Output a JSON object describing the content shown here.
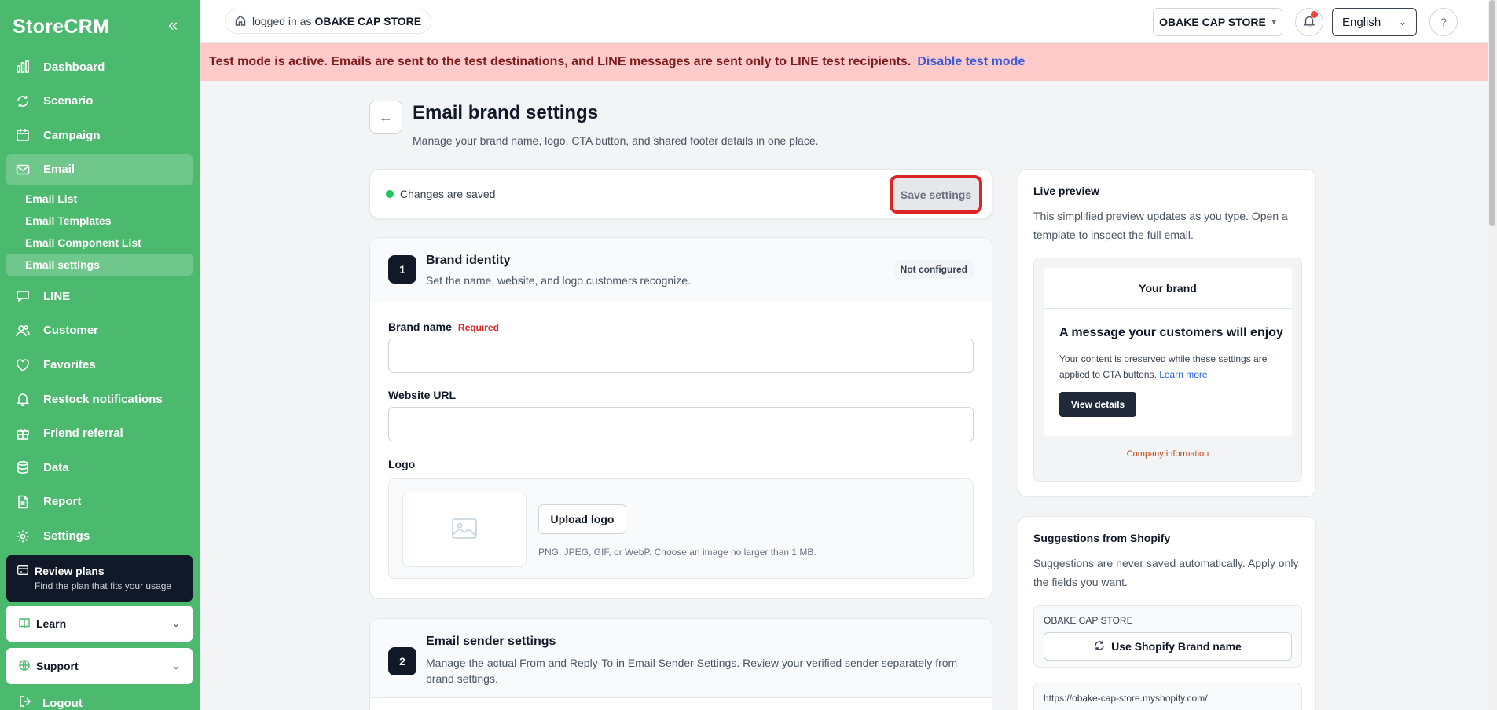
{
  "app": {
    "name": "StoreCRM"
  },
  "sidebar": {
    "items": [
      {
        "label": "Dashboard",
        "icon": "bar-chart-icon"
      },
      {
        "label": "Scenario",
        "icon": "refresh-icon"
      },
      {
        "label": "Campaign",
        "icon": "calendar-icon"
      },
      {
        "label": "Email",
        "icon": "mail-icon",
        "active": true
      },
      {
        "label": "LINE",
        "icon": "chat-icon"
      },
      {
        "label": "Customer",
        "icon": "users-icon"
      },
      {
        "label": "Favorites",
        "icon": "heart-icon"
      },
      {
        "label": "Restock notifications",
        "icon": "bell-icon"
      },
      {
        "label": "Friend referral",
        "icon": "gift-icon"
      },
      {
        "label": "Data",
        "icon": "database-icon"
      },
      {
        "label": "Report",
        "icon": "file-icon"
      },
      {
        "label": "Settings",
        "icon": "gear-icon"
      }
    ],
    "email_sub": [
      "Email List",
      "Email Templates",
      "Email Component List",
      "Email settings"
    ],
    "review": {
      "title": "Review plans",
      "subtitle": "Find the plan that fits your usage"
    },
    "learn": "Learn",
    "support": "Support",
    "logout": "Logout"
  },
  "topbar": {
    "logged_prefix": "logged in as",
    "store": "OBAKE CAP STORE",
    "store_select": "OBAKE CAP STORE",
    "language": "English"
  },
  "banner": {
    "text": "Test mode is active. Emails are sent to the test destinations, and LINE messages are sent only to LINE test recipients.",
    "link": "Disable test mode"
  },
  "page": {
    "title": "Email brand settings",
    "subtitle": "Manage your brand name, logo, CTA button, and shared footer details in one place."
  },
  "savebar": {
    "status": "Changes are saved",
    "save": "Save settings"
  },
  "brand_identity": {
    "step": "1",
    "title": "Brand identity",
    "desc": "Set the name, website, and logo customers recognize.",
    "badge": "Not configured",
    "brand_name_label": "Brand name",
    "required": "Required",
    "brand_name_value": "",
    "website_label": "Website URL",
    "website_value": "",
    "logo_label": "Logo",
    "upload": "Upload logo",
    "hint": "PNG, JPEG, GIF, or WebP. Choose an image no larger than 1 MB."
  },
  "sender": {
    "step": "2",
    "title": "Email sender settings",
    "desc": "Manage the actual From and Reply-To in Email Sender Settings. Review your verified sender separately from brand settings."
  },
  "preview": {
    "title": "Live preview",
    "desc": "This simplified preview updates as you type. Open a template to inspect the full email.",
    "brand": "Your brand",
    "headline": "A message your customers will enjoy",
    "body": "Your content is preserved while these settings are applied to CTA buttons.",
    "learn_more": "Learn more",
    "cta": "View details",
    "footer": "Company information"
  },
  "suggestions": {
    "title": "Suggestions from Shopify",
    "desc": "Suggestions are never saved automatically. Apply only the fields you want.",
    "store": "OBAKE CAP STORE",
    "use_brand": "Use Shopify Brand name",
    "url": "https://obake-cap-store.myshopify.com/"
  },
  "colors": {
    "sidebar": "#4cba6e",
    "banner": "#fecaca",
    "highlight": "#dc2626"
  }
}
